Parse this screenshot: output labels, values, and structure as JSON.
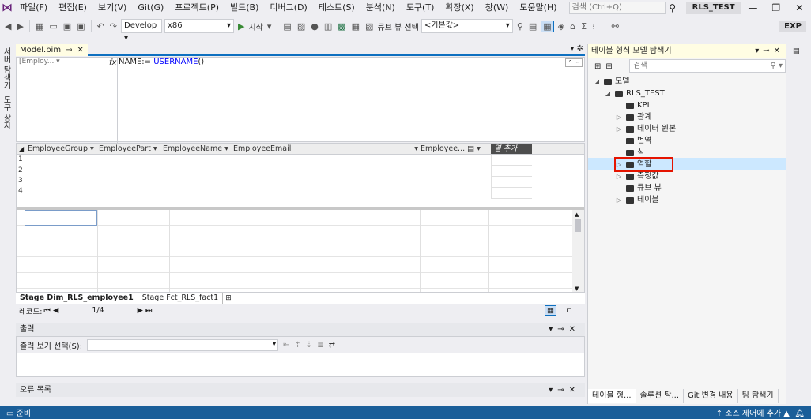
{
  "menubar": {
    "items": [
      "파일(F)",
      "편집(E)",
      "보기(V)",
      "Git(G)",
      "프로젝트(P)",
      "빌드(B)",
      "디버그(D)",
      "테스트(S)",
      "분석(N)",
      "도구(T)",
      "확장(X)",
      "창(W)",
      "도움말(H)"
    ],
    "search_placeholder": "검색 (Ctrl+Q)",
    "solution_name": "RLS_TEST"
  },
  "toolbar": {
    "config": "Develop",
    "platform": "x86",
    "start_label": "시작",
    "cube_view_label": "큐브 뷰 선택",
    "cube_view_value": "<기본값>",
    "exp_label": "EXP"
  },
  "left_strip": {
    "tabs": [
      "서버 탐색기",
      "도구 상자"
    ]
  },
  "document": {
    "tab_label": "Model.bim",
    "measure_combo": "[Employ...",
    "fx": "fx",
    "formula_prefix": "NAME:= ",
    "formula_func": "USERNAME",
    "formula_suffix": "()",
    "columns": [
      "EmployeeGroup",
      "EmployeePart",
      "EmployeeName",
      "EmployeeEmail",
      "Employee...",
      "열 추가"
    ],
    "row_numbers": [
      "1",
      "2",
      "3",
      "4"
    ],
    "sheet_tabs": [
      "Stage Dim_RLS_employee1",
      "Stage Fct_RLS_fact1"
    ],
    "record_label": "레코드:",
    "record_value": "1/4"
  },
  "output": {
    "title": "출력",
    "select_label": "출력 보기 선택(S):"
  },
  "errors": {
    "title": "오류 목록"
  },
  "tabular_explorer": {
    "title": "테이블 형식 모델 탐색기",
    "search_placeholder": "검색",
    "tree": [
      {
        "label": "모델",
        "level": 0,
        "arrow": "◢"
      },
      {
        "label": "RLS_TEST",
        "level": 1,
        "arrow": "◢"
      },
      {
        "label": "KPI",
        "level": 2,
        "arrow": ""
      },
      {
        "label": "관계",
        "level": 2,
        "arrow": "▷"
      },
      {
        "label": "데이터 원본",
        "level": 2,
        "arrow": "▷"
      },
      {
        "label": "번역",
        "level": 2,
        "arrow": ""
      },
      {
        "label": "식",
        "level": 2,
        "arrow": ""
      },
      {
        "label": "역할",
        "level": 2,
        "arrow": "▷"
      },
      {
        "label": "측정값",
        "level": 2,
        "arrow": "▷"
      },
      {
        "label": "큐브 뷰",
        "level": 2,
        "arrow": ""
      },
      {
        "label": "테이블",
        "level": 2,
        "arrow": "▷"
      }
    ],
    "bottom_tabs": [
      "테이블 형...",
      "솔루션 탐...",
      "Git 변경 내용",
      "팀 탐색기"
    ]
  },
  "statusbar": {
    "left": "준비",
    "right": "↑ 소스 제어에 추가 ▲"
  },
  "colors": {
    "accent": "#0e70c0",
    "statusbar": "#1a5e99",
    "highlight": "#e51400"
  }
}
